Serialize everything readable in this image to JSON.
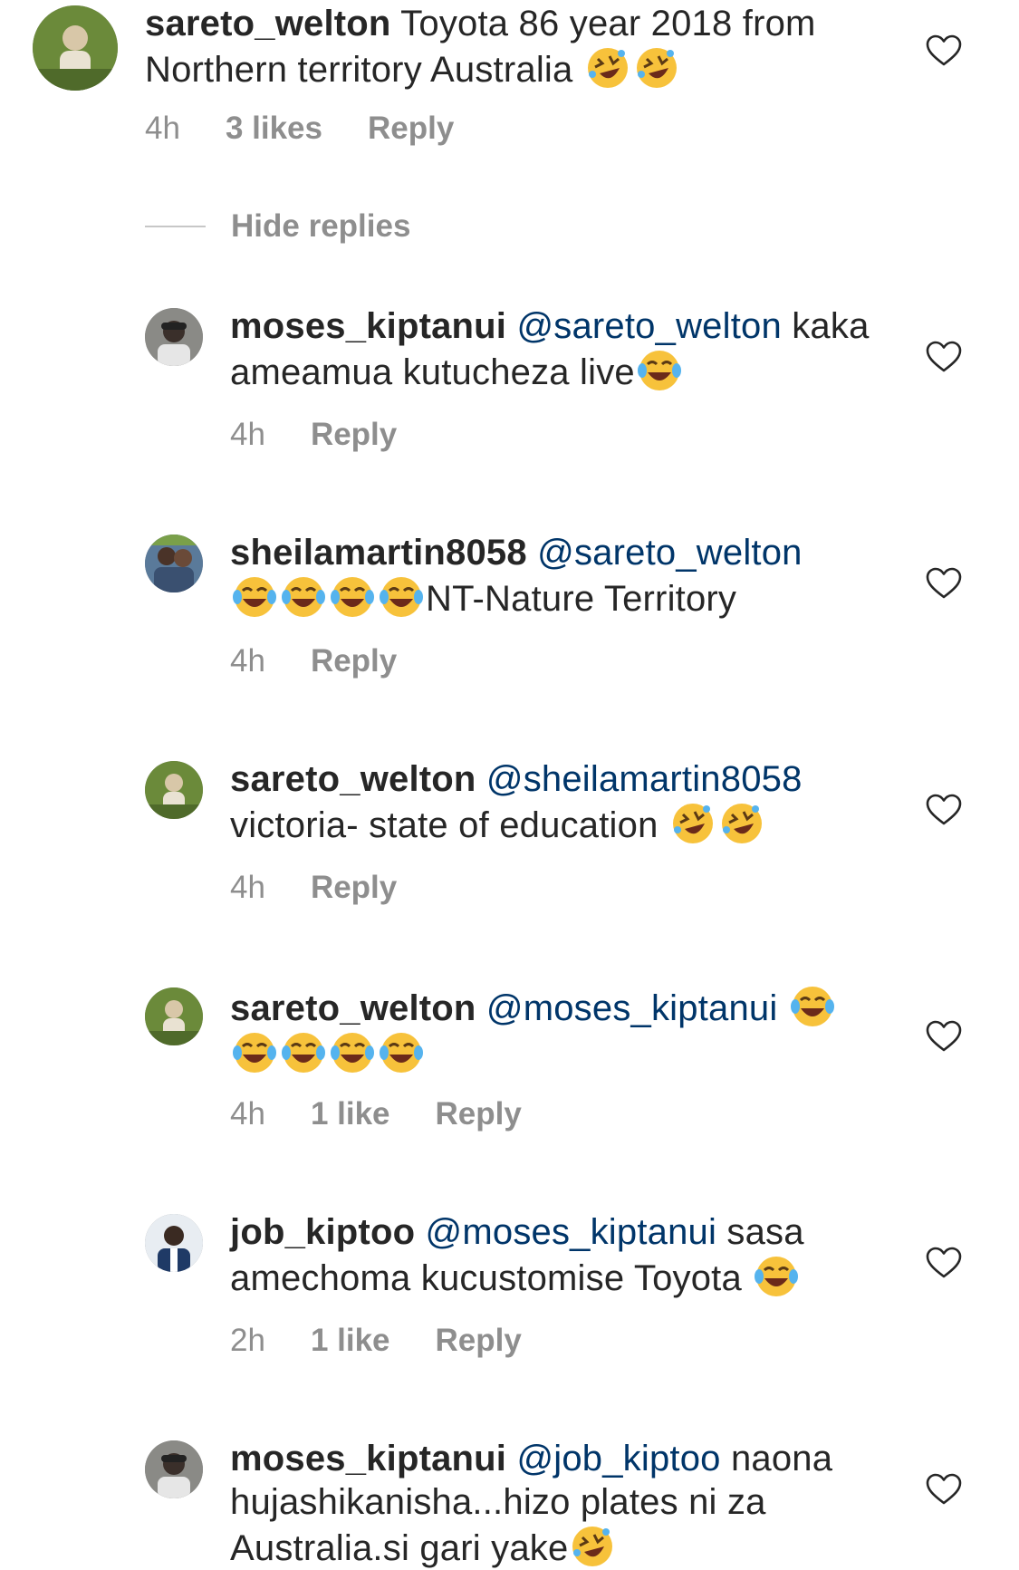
{
  "comments": [
    {
      "username": "sareto_welton",
      "mention": "",
      "text_before_emoji": " Toyota 86 year 2018 from Northern territory Australia ",
      "time": "4h",
      "likes": "3 likes",
      "reply": "Reply",
      "emoji_sequence": [
        "rofl-emoji",
        "rofl-emoji"
      ]
    },
    {
      "username": "moses_kiptanui",
      "mention": "@sareto_welton",
      "text_before_emoji": "kaka ameamua kutucheza live",
      "time": "4h",
      "likes": "",
      "reply": "Reply",
      "emoji_sequence": [
        "joy-emoji"
      ]
    },
    {
      "username": "sheilamartin8058",
      "mention": "@sareto_welton",
      "text_before_emoji": "",
      "text_after_emoji": "NT-Nature Territory",
      "time": "4h",
      "likes": "",
      "reply": "Reply",
      "emoji_sequence": [
        "joy-emoji",
        "joy-emoji",
        "joy-emoji",
        "joy-emoji"
      ]
    },
    {
      "username": "sareto_welton",
      "mention": "@sheilamartin8058",
      "text_before_emoji": "victoria- state of education ",
      "time": "4h",
      "likes": "",
      "reply": "Reply",
      "emoji_sequence": [
        "rofl-emoji",
        "rofl-emoji"
      ]
    },
    {
      "username": "sareto_welton",
      "mention": "@moses_kiptanui",
      "text_before_emoji": " ",
      "time": "4h",
      "likes": "1 like",
      "reply": "Reply",
      "emoji_sequence": [
        "joy-emoji",
        "joy-emoji",
        "joy-emoji",
        "joy-emoji",
        "joy-emoji"
      ]
    },
    {
      "username": "job_kiptoo",
      "mention": "@moses_kiptanui",
      "text_before_emoji": " sasa amechoma kucustomise Toyota ",
      "time": "2h",
      "likes": "1 like",
      "reply": "Reply",
      "emoji_sequence": [
        "joy-emoji"
      ]
    },
    {
      "username": "moses_kiptanui",
      "mention": "@job_kiptoo",
      "text_before_emoji": " naona hujashikanisha...hizo plates ni za Australia.si gari yake",
      "time": "",
      "likes": "",
      "reply": "",
      "emoji_sequence": [
        "rofl-emoji"
      ]
    }
  ],
  "hide_replies_label": "Hide replies",
  "icons": {
    "like": "heart-outline-icon"
  },
  "colors": {
    "text": "#262626",
    "mention": "#003569",
    "meta": "#8e8e8e",
    "heart": "#262626"
  }
}
